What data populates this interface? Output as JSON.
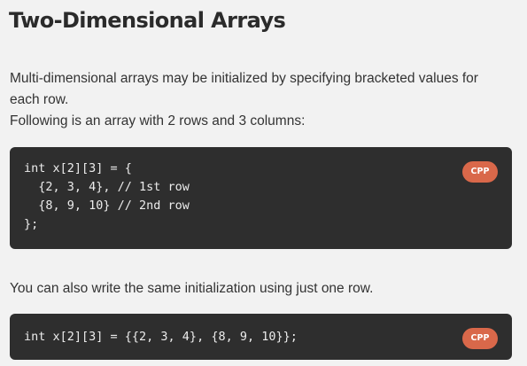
{
  "section": {
    "title": "Two-Dimensional Arrays",
    "intro_lines": [
      "Multi-dimensional arrays may be initialized by specifying bracketed values for",
      "each row.",
      "Following is an array with 2 rows and 3 columns:"
    ],
    "code_block_1": {
      "language_badge": "CPP",
      "lines": [
        "int x[2][3] = {",
        "  {2, 3, 4}, // 1st row",
        "  {8, 9, 10} // 2nd row",
        "};"
      ]
    },
    "followup_text": "You can also write the same initialization using just one row.",
    "code_block_2": {
      "language_badge": "CPP",
      "lines": [
        "int x[2][3] = {{2, 3, 4}, {8, 9, 10}};"
      ]
    }
  },
  "colors": {
    "page_background": "#f2f2f2",
    "code_background": "#2e2e2e",
    "badge_background": "#d9684a",
    "badge_text": "#ffffff",
    "code_text": "#ececec",
    "body_text": "#333333"
  }
}
